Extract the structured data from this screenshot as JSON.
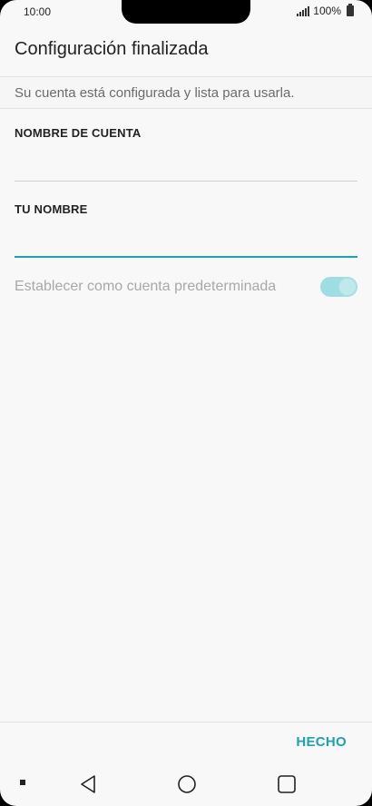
{
  "status_bar": {
    "time": "10:00",
    "battery": "100%"
  },
  "header": {
    "title": "Configuración finalizada"
  },
  "subtitle": "Su cuenta está configurada y lista para usarla.",
  "fields": {
    "account_name_label": "NOMBRE DE CUENTA",
    "account_name_value": "",
    "your_name_label": "TU NOMBRE",
    "your_name_value": ""
  },
  "settings": {
    "default_account_label": "Establecer como cuenta predeterminada",
    "default_account_enabled": true
  },
  "footer": {
    "done_label": "HECHO"
  },
  "icons": {
    "back": "back-triangle-icon",
    "home": "home-circle-icon",
    "recent": "recent-square-icon"
  },
  "colors": {
    "accent": "#1aa3b3",
    "toggle_track": "#9edde3"
  }
}
